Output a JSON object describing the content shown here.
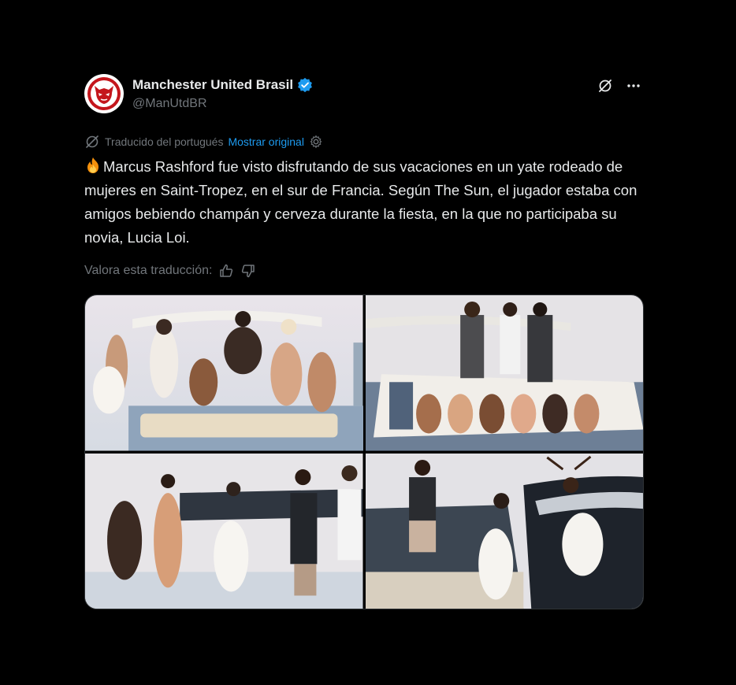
{
  "tweet": {
    "author_name": "Manchester United Brasil",
    "author_handle": "@ManUtdBR",
    "translated_from": "Traducido del portugués",
    "show_original": "Mostrar original",
    "text": "Marcus Rashford fue visto disfrutando de sus vacaciones en un yate rodeado de mujeres en Saint-Tropez, en el sur de Francia. Según The Sun, el jugador estaba con amigos bebiendo champán y cerveza durante la fiesta, en la que no participaba su novia, Lucia Loi.",
    "rate_translation": "Valora esta traducción:"
  },
  "colors": {
    "background": "#000000",
    "text": "#e7e9ea",
    "muted": "#71767b",
    "link": "#1d9bf0",
    "verified": "#1d9bf0",
    "logo_red": "#c4161c"
  },
  "icons": {
    "avatar": "manutd-devil-logo",
    "verified": "verified-badge-icon",
    "grok": "grok-icon",
    "more": "more-icon",
    "translate": "translate-icon",
    "settings": "gear-icon",
    "thumbs_up": "thumbs-up-icon",
    "thumbs_down": "thumbs-down-icon",
    "fire": "fire-emoji"
  },
  "media": {
    "photos": [
      {
        "alt": "yacht-photo-1"
      },
      {
        "alt": "yacht-photo-2"
      },
      {
        "alt": "yacht-photo-3"
      },
      {
        "alt": "yacht-photo-4"
      }
    ]
  }
}
